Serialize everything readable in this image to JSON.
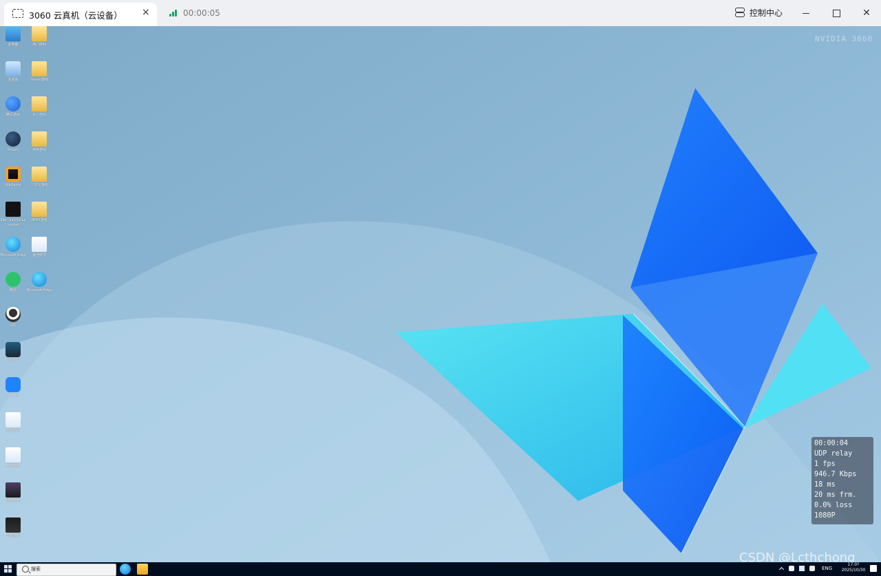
{
  "window": {
    "tab_title": "3060 云真机（云设备）",
    "timer": "00:00:05",
    "control_center_label": "控制中心",
    "window_buttons": {
      "minimize": "minimize",
      "maximize": "maximize",
      "close": "close"
    }
  },
  "desktop": {
    "watermark": "NVIDIA 3060",
    "icons": [
      {
        "label": "此电脑",
        "icon": "computer-icon"
      },
      {
        "label": "回收站",
        "icon": "recycle-bin-icon"
      },
      {
        "label": "腾讯游戏",
        "icon": "blue-app-icon"
      },
      {
        "label": "Steam",
        "icon": "steam-icon"
      },
      {
        "label": "WeGame",
        "icon": "wegame-icon"
      },
      {
        "label": "Epic Games Launcher",
        "icon": "epic-icon"
      },
      {
        "label": "Microsoft Edge",
        "icon": "edge-icon"
      },
      {
        "label": "微信",
        "icon": "wechat-icon"
      },
      {
        "label": "QQ",
        "icon": "qq-icon"
      },
      {
        "label": "QQ飞车",
        "icon": "game-icon"
      },
      {
        "label": "MOMO",
        "icon": "momo-icon"
      },
      {
        "label": "桌面游戏",
        "icon": "document-icon"
      },
      {
        "label": "实用游戏",
        "icon": "document-icon"
      },
      {
        "label": "网游游戏",
        "icon": "dark-icon"
      },
      {
        "label": "单机游戏",
        "icon": "black-icon"
      },
      {
        "label": "热门游戏",
        "icon": "folder-icon"
      },
      {
        "label": "Steam游戏",
        "icon": "folder-icon"
      },
      {
        "label": "多人游戏",
        "icon": "folder-icon"
      },
      {
        "label": "常用游戏",
        "icon": "folder-icon"
      },
      {
        "label": "二次元游戏",
        "icon": "folder-icon"
      },
      {
        "label": "WHIS游戏",
        "icon": "folder-icon"
      },
      {
        "label": "其他软件",
        "icon": "document-icon"
      },
      {
        "label": "Microsoft Edge",
        "icon": "edge-icon"
      }
    ]
  },
  "stats": [
    "00:00:04",
    "UDP relay",
    "1 fps",
    "946.7 Kbps",
    "18 ms",
    "20 ms frm.",
    "0.0% loss",
    "1080P"
  ],
  "watermark": "CSDN @Lcthchong",
  "taskbar": {
    "search_placeholder": "搜索",
    "language": "ENG",
    "time": "17:0?",
    "date": "2025/10/30"
  }
}
